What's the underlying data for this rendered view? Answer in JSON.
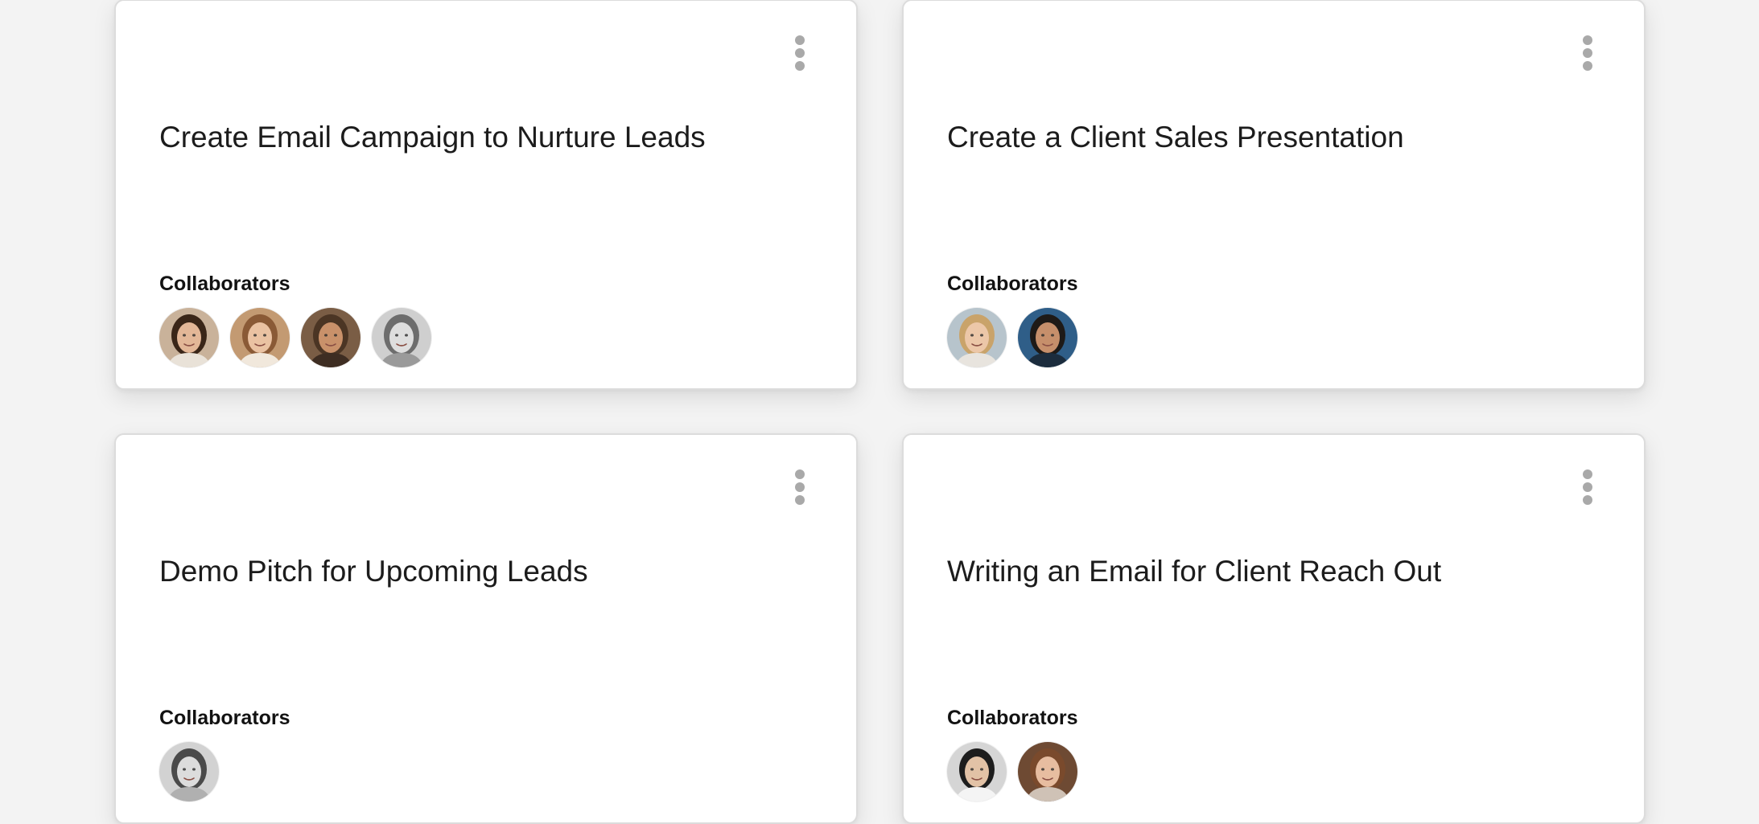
{
  "cards": [
    {
      "title": "Create Email Campaign to Nurture Leads",
      "collaborators_label": "Collaborators",
      "avatars": [
        {
          "bg": "#c9b29a",
          "hair": "#3a2618",
          "skin": "#e3b797",
          "shirt": "#e9e2d8"
        },
        {
          "bg": "#c39a72",
          "hair": "#8a5a36",
          "skin": "#eac2a2",
          "shirt": "#f1e8dc"
        },
        {
          "bg": "#7a5d45",
          "hair": "#4b3524",
          "skin": "#c9916a",
          "shirt": "#3e2d22"
        },
        {
          "bg": "#cfcfcf",
          "hair": "#6d6d6d",
          "skin": "#dedede",
          "shirt": "#9a9a9a"
        }
      ]
    },
    {
      "title": "Create a Client Sales Presentation",
      "collaborators_label": "Collaborators",
      "avatars": [
        {
          "bg": "#b7c4cc",
          "hair": "#c9a36a",
          "skin": "#ecc7a8",
          "shirt": "#e8e4de"
        },
        {
          "bg": "#2f5e88",
          "hair": "#1e1a17",
          "skin": "#c68f6b",
          "shirt": "#1b2c3d"
        }
      ]
    },
    {
      "title": "Demo Pitch for Upcoming Leads",
      "collaborators_label": "Collaborators",
      "avatars": [
        {
          "bg": "#d2d2d2",
          "hair": "#4a4a4a",
          "skin": "#dcdcdc",
          "shirt": "#b0b0b0"
        }
      ]
    },
    {
      "title": "Writing an Email for Client Reach Out",
      "collaborators_label": "Collaborators",
      "avatars": [
        {
          "bg": "#d5d5d5",
          "hair": "#1d1d1d",
          "skin": "#e2c2a6",
          "shirt": "#f4f4f4"
        },
        {
          "bg": "#6e4a33",
          "hair": "#7a4a2c",
          "skin": "#e7bda0",
          "shirt": "#cfc2b6"
        }
      ]
    }
  ],
  "icons": {
    "menu": "more-vertical-icon",
    "avatar": "person-photo"
  }
}
